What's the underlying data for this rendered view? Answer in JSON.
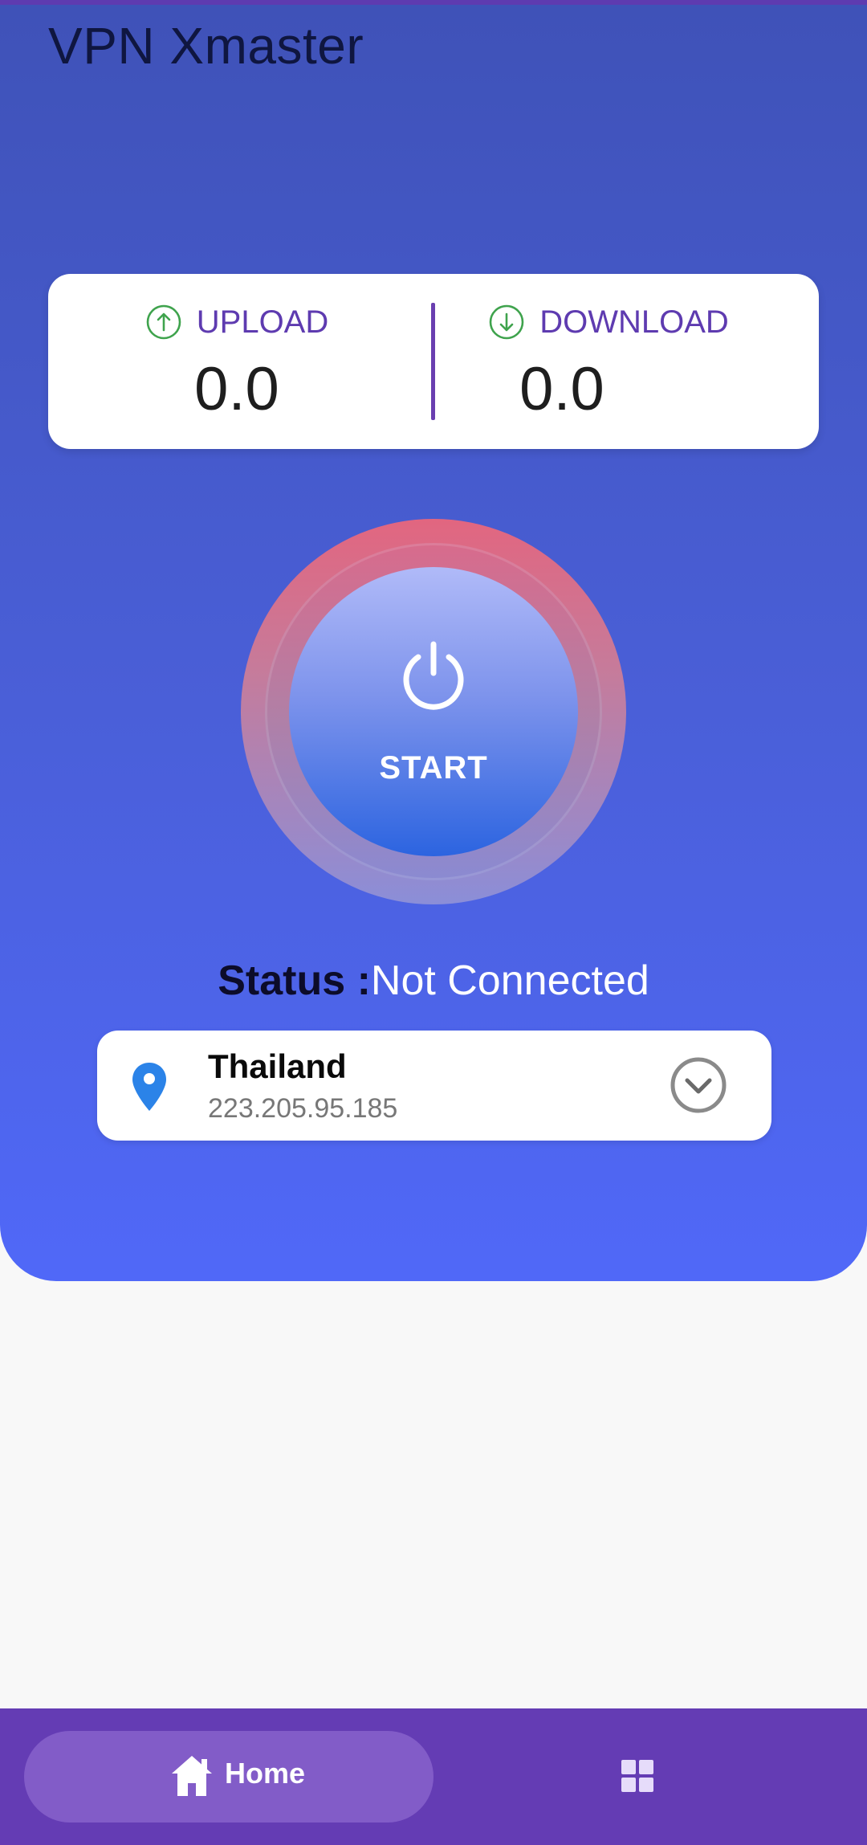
{
  "app": {
    "title": "VPN Xmaster"
  },
  "stats": {
    "upload_label": "UPLOAD",
    "upload_value": "0.0",
    "upload_icon": "arrow-up-circle-icon",
    "download_label": "DOWNLOAD",
    "download_value": "0.0",
    "download_icon": "arrow-down-circle-icon"
  },
  "power": {
    "label": "START",
    "icon": "power-icon"
  },
  "status": {
    "label": "Status :",
    "value": "Not Connected"
  },
  "server": {
    "country": "Thailand",
    "ip": "223.205.95.185",
    "pin_icon": "location-pin-icon",
    "expand_icon": "chevron-down-circle-icon"
  },
  "nav": {
    "home_label": "Home",
    "home_icon": "home-icon",
    "grid_icon": "grid-icon"
  },
  "colors": {
    "accent": "#643cb4",
    "hero_top": "#3f52b8",
    "hero_bottom": "#5068f8",
    "ring_pink": "#e5667e",
    "button_blue": "#2c64e0",
    "stat_icon_green": "#3fa34d",
    "pin_blue": "#2b83e8",
    "label_purple": "#5e3bb0"
  }
}
